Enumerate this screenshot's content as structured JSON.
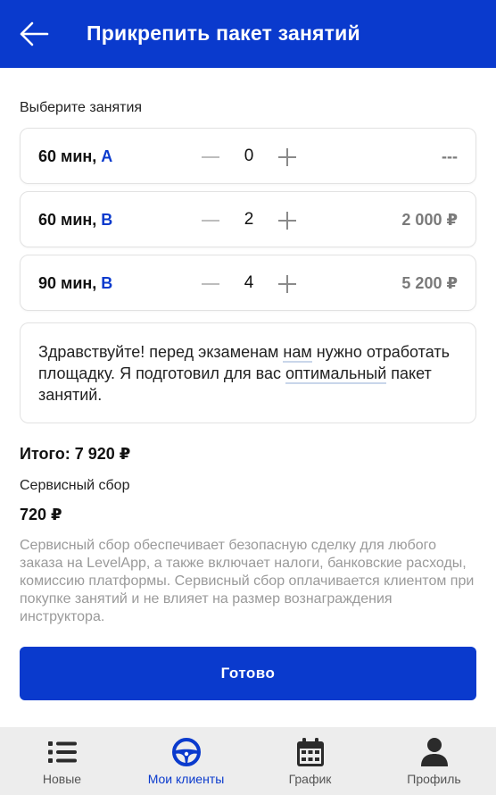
{
  "header": {
    "title": "Прикрепить пакет занятий"
  },
  "section_label": "Выберите занятия",
  "lessons": [
    {
      "duration": "60 мин,",
      "category": "A",
      "quantity": "0",
      "price": "---"
    },
    {
      "duration": "60 мин,",
      "category": "B",
      "quantity": "2",
      "price": "2 000 ₽"
    },
    {
      "duration": "90 мин,",
      "category": "B",
      "quantity": "4",
      "price": "5 200 ₽"
    }
  ],
  "message": {
    "part1": "Здравствуйте! перед экзаменам ",
    "part2": "нам",
    "part3": " нужно отработать площадку. Я подготовил для вас ",
    "part4": "оптимальный",
    "part5": " пакет занятий."
  },
  "summary": {
    "total": "Итого: 7 920 ₽",
    "fee_label": "Сервисный сбор",
    "fee_value": "720 ₽",
    "fee_description": "Сервисный сбор обеспечивает безопасную сделку для любого заказа на LevelApp, а также включает налоги, банковские расходы, комиссию платформы. Сервисный сбор оплачивается клиентом при покупке занятий и не влияет на размер вознаграждения инструктора."
  },
  "done_button": "Готово",
  "tabs": [
    {
      "label": "Новые",
      "icon": "list-icon",
      "active": false
    },
    {
      "label": "Мои клиенты",
      "icon": "steering-wheel-icon",
      "active": true
    },
    {
      "label": "График",
      "icon": "calendar-icon",
      "active": false
    },
    {
      "label": "Профиль",
      "icon": "user-icon",
      "active": false
    }
  ],
  "colors": {
    "brand": "#0a3acd",
    "tabbar_bg": "#ededed",
    "muted_text": "#9a9a9a"
  }
}
